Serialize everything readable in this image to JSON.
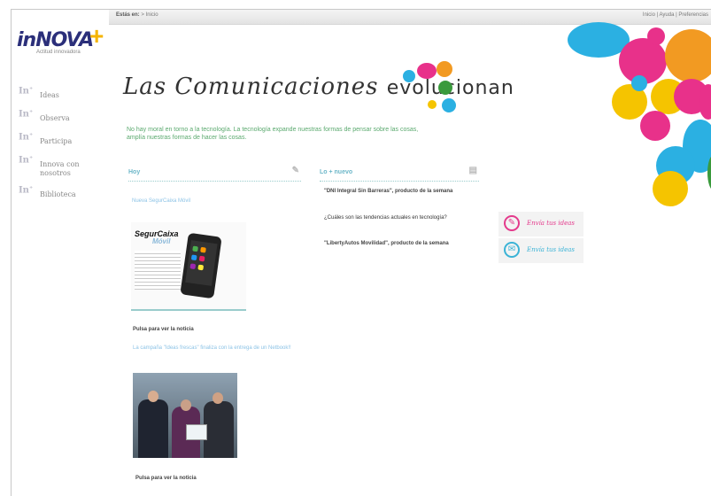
{
  "breadcrumb": {
    "prefix": "Estás en:",
    "separator": ">",
    "current": "Inicio"
  },
  "top_links": [
    "Inicio",
    "Ayuda",
    "Preferencias"
  ],
  "logo": {
    "name": "innova",
    "tagline": "Actitud innovadora"
  },
  "nav": {
    "icon_text": "In",
    "items": [
      "Ideas",
      "Observa",
      "Participa",
      "Innova con nosotros",
      "Biblioteca"
    ]
  },
  "hero": {
    "title_part1": "Las Comunicaciones ",
    "title_part2": "evolucionan"
  },
  "intro": "No hay moral en torno a la tecnología. La tecnología expande nuestras formas de pensar sobre las cosas, amplía nuestras formas de hacer las cosas.",
  "hoy": {
    "heading": "Hoy",
    "news1_title": "Nueva SegurCaixa Móvil",
    "news1_img_brand": "SegurCaixa",
    "news1_img_brand2": "Móvil",
    "news1_cta": "Pulsa para ver la noticia",
    "news2_title": "La campaña \"Ideas frescas\" finaliza con la entrega de un Netbook!!",
    "news2_cta": "Pulsa para ver la noticia"
  },
  "nuevo": {
    "heading": "Lo + nuevo",
    "items": [
      "\"DNI Integral Sin Barreras\", producto de la semana",
      "¿Cuáles son las tendencias actuales en tecnología?",
      "\"LibertyAutos Movilidad\", producto de la semana"
    ]
  },
  "side_buttons": [
    {
      "label": "Envía tus ideas",
      "icon": "bulb-icon",
      "color": "#e43a8c"
    },
    {
      "label": "Envía tus ideas",
      "icon": "globe-icon",
      "color": "#3bb3d6"
    }
  ]
}
